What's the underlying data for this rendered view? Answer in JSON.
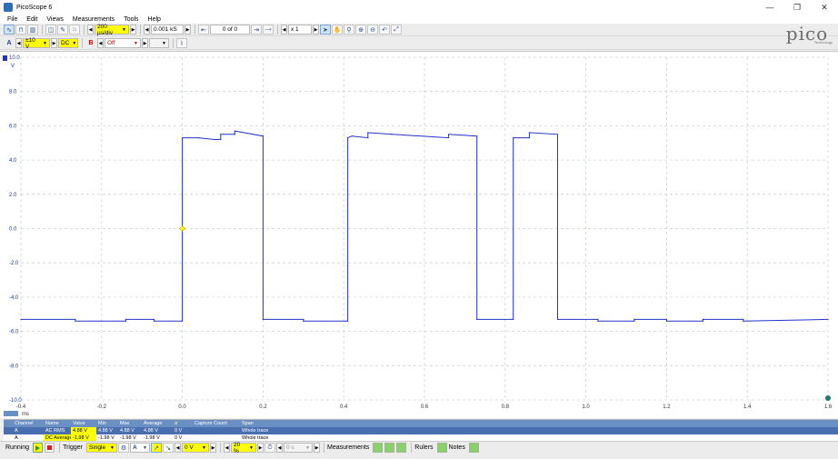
{
  "window": {
    "title": "PicoScope 6",
    "minimize": "—",
    "restore": "❐",
    "close": "✕"
  },
  "menu": [
    "File",
    "Edit",
    "Views",
    "Measurements",
    "Tools",
    "Help"
  ],
  "toolbar1": {
    "timebase": "200 µs/div",
    "samples": "0.001 kS",
    "buffer": "0 of 0",
    "zoom": "x 1"
  },
  "toolbar2": {
    "channel_a_label": "A",
    "channel_a_range": "±10 V",
    "channel_a_coupling": "DC",
    "channel_b_label": "B",
    "channel_b_range": "Off"
  },
  "logo": {
    "word": "pico",
    "sub": "Technology"
  },
  "chart_data": {
    "type": "line",
    "ylabel": "V",
    "xlabel": "ms",
    "xlim": [
      -0.4,
      1.6
    ],
    "ylim": [
      -10,
      10
    ],
    "x_ticks": [
      "-0.4",
      "-0.2",
      "0.0",
      "0.2",
      "0.4",
      "0.6",
      "0.8",
      "1.0",
      "1.2",
      "1.4",
      "1.6"
    ],
    "y_ticks": [
      "10.0",
      "8.0",
      "6.0",
      "4.0",
      "2.0",
      "0.0",
      "-2.0",
      "-4.0",
      "-6.0",
      "-8.0",
      "-10.0"
    ],
    "grid": true,
    "trigger_marker": {
      "x": 0.0,
      "y": 0.0
    },
    "series": [
      {
        "color": "#2233cc",
        "x": [
          -0.4,
          -0.265,
          -0.265,
          -0.14,
          -0.14,
          -0.07,
          -0.07,
          0.0,
          0.0,
          0.04,
          0.08,
          0.095,
          0.095,
          0.13,
          0.13,
          0.2,
          0.2,
          0.3,
          0.3,
          0.41,
          0.41,
          0.42,
          0.46,
          0.46,
          0.52,
          0.66,
          0.66,
          0.73,
          0.73,
          0.82,
          0.82,
          0.86,
          0.86,
          0.93,
          0.93,
          1.03,
          1.03,
          1.12,
          1.12,
          1.2,
          1.2,
          1.29,
          1.29,
          1.39,
          1.39,
          1.6
        ],
        "y": [
          -5.3,
          -5.3,
          -5.4,
          -5.4,
          -5.3,
          -5.3,
          -5.4,
          -5.4,
          5.3,
          5.3,
          5.2,
          5.2,
          5.5,
          5.5,
          5.7,
          5.4,
          -5.3,
          -5.3,
          -5.4,
          -5.4,
          5.3,
          5.4,
          5.3,
          5.6,
          5.5,
          5.3,
          5.5,
          5.4,
          -5.3,
          -5.3,
          5.3,
          5.3,
          5.6,
          5.5,
          -5.3,
          -5.3,
          -5.4,
          -5.4,
          -5.3,
          -5.3,
          -5.4,
          -5.4,
          -5.3,
          -5.3,
          -5.4,
          -5.3
        ]
      }
    ]
  },
  "measurements": {
    "headers": [
      "Channel",
      "Name",
      "Value",
      "Min",
      "Max",
      "Average",
      "σ",
      "Capture Count",
      "Span"
    ],
    "rows": [
      [
        "A",
        "AC RMS",
        "4.88 V",
        "4.88 V",
        "4.88 V",
        "4.88 V",
        "0 V",
        "",
        "Whole trace"
      ],
      [
        "A",
        "DC Average",
        "-1.98 V",
        "-1.98 V",
        "-1.98 V",
        "-1.98 V",
        "0 V",
        "",
        "Whole trace"
      ]
    ]
  },
  "bottombar": {
    "running": "Running",
    "trigger": "Trigger",
    "trigger_mode": "Single",
    "trigger_channel": "A",
    "threshold": "0 V",
    "pretrigger": "20 %",
    "delay": "0 s",
    "measurements": "Measurements",
    "rulers": "Rulers",
    "notes": "Notes"
  }
}
